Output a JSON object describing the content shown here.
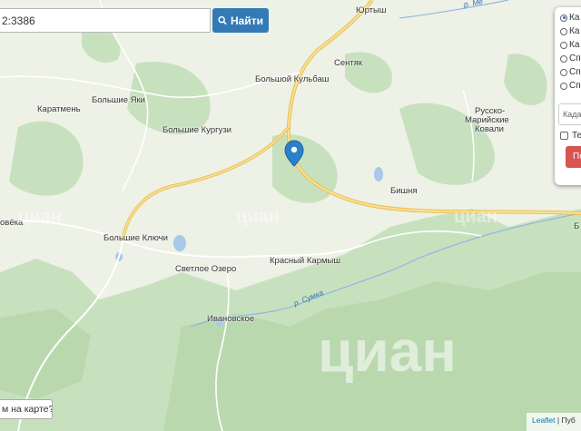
{
  "search": {
    "value": "2:3386",
    "button_label": "Найти"
  },
  "places": [
    {
      "name": "Юртыш"
    },
    {
      "name": "Сентяк"
    },
    {
      "name": "Большой Кульбаш"
    },
    {
      "name": "Большие Яки"
    },
    {
      "name": "Каратмень"
    },
    {
      "name": "Большие Кургузи"
    },
    {
      "name": "Русско-"
    },
    {
      "name": "Марийские"
    },
    {
      "name": "Ковали"
    },
    {
      "name": "Бишня"
    },
    {
      "name": "Большие Ключи"
    },
    {
      "name": "овёка"
    },
    {
      "name": "Светлое Озеро"
    },
    {
      "name": "Красный Кармыш"
    },
    {
      "name": "Ивановское"
    },
    {
      "name": "Б"
    }
  ],
  "rivers": {
    "sumka": "р. Сумка",
    "top": "р. Ме"
  },
  "panel": {
    "layers": [
      {
        "label": "Ка",
        "selected": true
      },
      {
        "label": "Ка",
        "selected": false
      },
      {
        "label": "Ка",
        "selected": false
      },
      {
        "label": "Сп",
        "selected": false
      },
      {
        "label": "Сп",
        "selected": false
      },
      {
        "label": "Сп",
        "selected": false
      }
    ],
    "cadastre_placeholder": "Кадаст",
    "checkbox_label": "Те",
    "button_label": "По"
  },
  "bottom_button": "м на карте?",
  "attribution": {
    "leaflet": "Leaflet",
    "suffix": " | Пуб"
  },
  "watermark": {
    "text": "циан",
    "small": "циан"
  },
  "colors": {
    "water": "#aac8e8",
    "forest": "#c7e1bf",
    "field": "#eef1e6",
    "road": "#f3d77a",
    "marker": "#2a81cb",
    "search_button": "#337ab7",
    "action_button": "#d9534f"
  }
}
